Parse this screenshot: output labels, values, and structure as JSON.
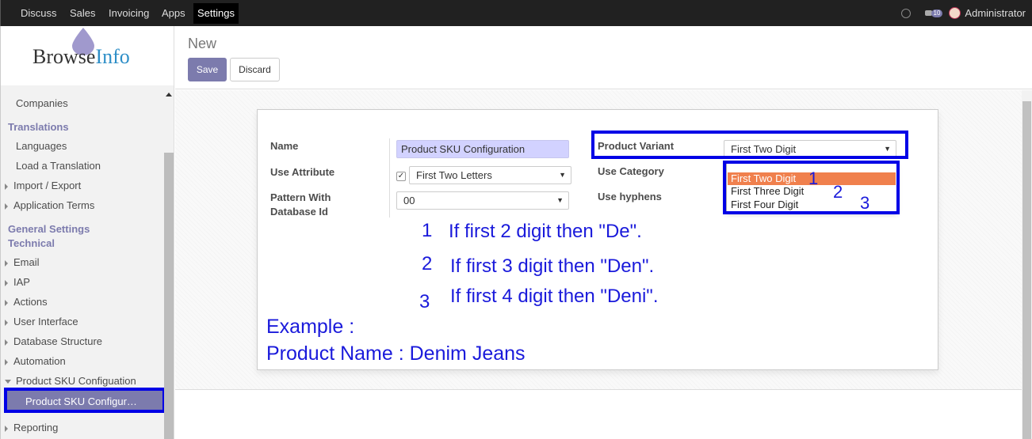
{
  "topbar": {
    "menus": [
      "Discuss",
      "Sales",
      "Invoicing",
      "Apps",
      "Settings"
    ],
    "active": "Settings",
    "chat_count": "10",
    "user": "Administrator"
  },
  "logo": {
    "text_a": "Browse",
    "text_b": "Info"
  },
  "sidebar": {
    "items": [
      {
        "label": "Companies",
        "kind": "l1"
      },
      {
        "label": "Translations",
        "kind": "cat"
      },
      {
        "label": "Languages",
        "kind": "l1"
      },
      {
        "label": "Load a Translation",
        "kind": "l1"
      },
      {
        "label": "Import / Export",
        "kind": "arr"
      },
      {
        "label": "Application Terms",
        "kind": "arr"
      },
      {
        "label": "General Settings",
        "kind": "cat"
      },
      {
        "label": "Technical",
        "kind": "cat"
      },
      {
        "label": "Email",
        "kind": "arr"
      },
      {
        "label": "IAP",
        "kind": "arr"
      },
      {
        "label": "Actions",
        "kind": "arr"
      },
      {
        "label": "User Interface",
        "kind": "arr"
      },
      {
        "label": "Database Structure",
        "kind": "arr"
      },
      {
        "label": "Automation",
        "kind": "arr"
      },
      {
        "label": "Product SKU Configuation",
        "kind": "open"
      },
      {
        "label": "Product SKU Configur…",
        "kind": "selected"
      },
      {
        "label": "Reporting",
        "kind": "arr"
      }
    ]
  },
  "control": {
    "breadcrumb": "New",
    "save_label": "Save",
    "discard_label": "Discard"
  },
  "form": {
    "name_label": "Name",
    "name_value": "Product SKU Configuration",
    "use_attribute_label": "Use Attribute",
    "use_attribute_value": "First Two Letters",
    "pattern_label_1": "Pattern With",
    "pattern_label_2": "Database Id",
    "pattern_value": "00",
    "product_variant_label": "Product Variant",
    "product_variant_value": "First Two Digit",
    "use_category_label": "Use Category",
    "use_hyphens_label": "Use hyphens",
    "dropdown_options": [
      "First Two Digit",
      "First Three Digit",
      "First Four Digit"
    ]
  },
  "annotations": {
    "num1": "1",
    "num2": "2",
    "num3": "3",
    "line1": "If first 2 digit then \"De\".",
    "line2": "If first 3 digit then \"Den\".",
    "line3": "If first 4 digit then \"Deni\".",
    "example": "Example :",
    "product": "Product Name : Denim Jeans"
  },
  "colors": {
    "accent": "#7c7bad",
    "highlight": "#f0804d",
    "annotation_blue": "#0000e6"
  }
}
